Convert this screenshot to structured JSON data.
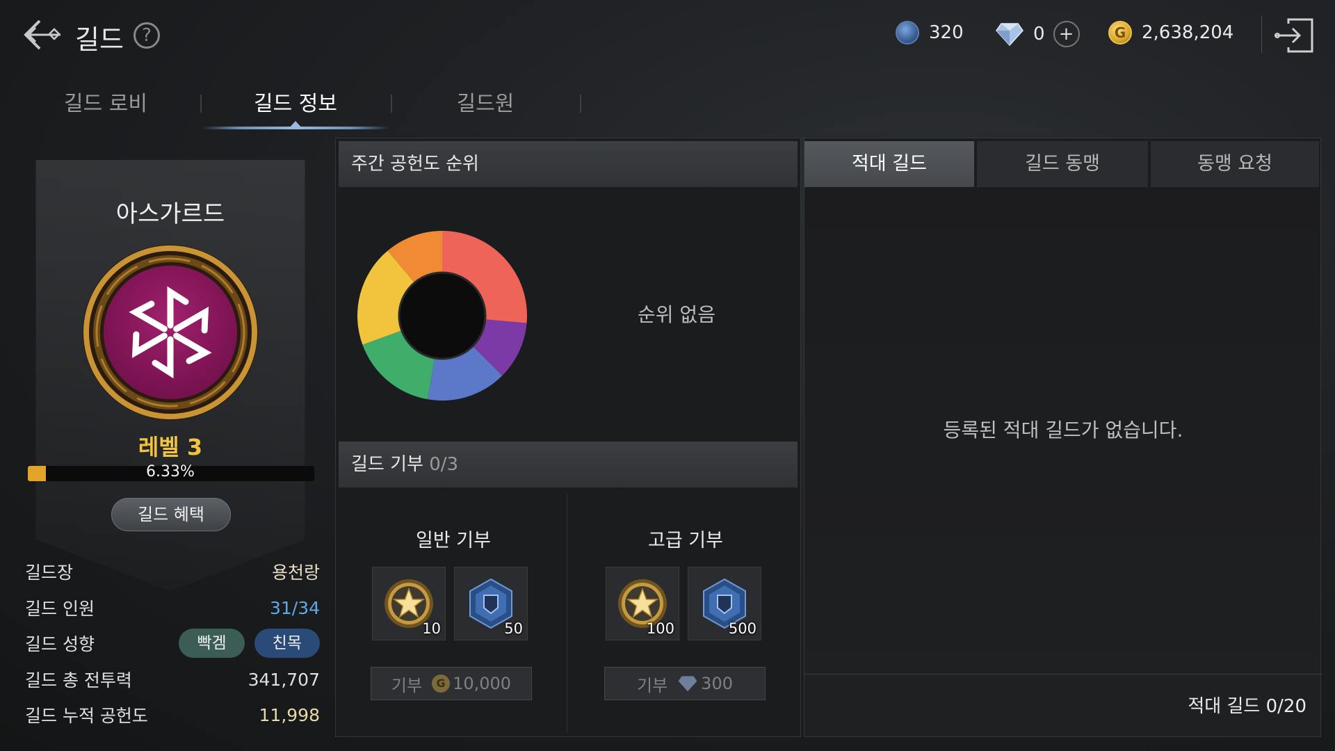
{
  "header": {
    "title": "길드",
    "currencies": [
      {
        "name": "guild-coin",
        "value": "320",
        "color": "#4a6fa8"
      },
      {
        "name": "diamond",
        "value": "0",
        "color": "#8fb0d8"
      },
      {
        "name": "gold",
        "value": "2,638,204",
        "color": "#d9a62b"
      }
    ],
    "plus_label": "+"
  },
  "tabs": [
    {
      "label": "길드 로비",
      "active": false
    },
    {
      "label": "길드 정보",
      "active": true
    },
    {
      "label": "길드원",
      "active": false
    }
  ],
  "guild": {
    "name": "아스가르드",
    "level": "레벨 3",
    "progress_percent": 6.33,
    "progress_text": "6.33%",
    "benefit_button": "길드 혜택",
    "emblem_colors": {
      "ring": "#b8862b",
      "inner": "#8f1660"
    },
    "info": [
      {
        "label": "길드장",
        "value": "용천랑"
      },
      {
        "label": "길드 인원",
        "value": "31/34"
      },
      {
        "label": "길드 성향",
        "tags": [
          "빡겜",
          "친목"
        ]
      },
      {
        "label": "길드 총 전투력",
        "value": "341,707"
      },
      {
        "label": "길드 누적 공헌도",
        "value": "11,998"
      }
    ]
  },
  "weekly_rank": {
    "title": "주간 공헌도 순위",
    "empty": "순위 없음",
    "donut_colors": [
      "#ef6459",
      "#7b3aa6",
      "#5b78c9",
      "#3fae6b",
      "#f2c33c",
      "#f08a34"
    ]
  },
  "donation": {
    "title": "길드 기부",
    "count": "0/3",
    "normal": {
      "title": "일반 기부",
      "items": [
        {
          "icon": "star-medal",
          "qty": "10"
        },
        {
          "icon": "guild-coin",
          "qty": "50"
        }
      ],
      "button": "기부",
      "cost": "10,000",
      "cost_currency": "gold"
    },
    "premium": {
      "title": "고급 기부",
      "items": [
        {
          "icon": "star-medal",
          "qty": "100"
        },
        {
          "icon": "guild-coin",
          "qty": "500"
        }
      ],
      "button": "기부",
      "cost": "300",
      "cost_currency": "diamond"
    }
  },
  "relations": {
    "tabs": [
      {
        "label": "적대 길드",
        "active": true
      },
      {
        "label": "길드 동맹",
        "active": false
      },
      {
        "label": "동맹 요청",
        "active": false
      }
    ],
    "empty": "등록된 적대 길드가 없습니다.",
    "count_label": "적대 길드 0/20"
  }
}
